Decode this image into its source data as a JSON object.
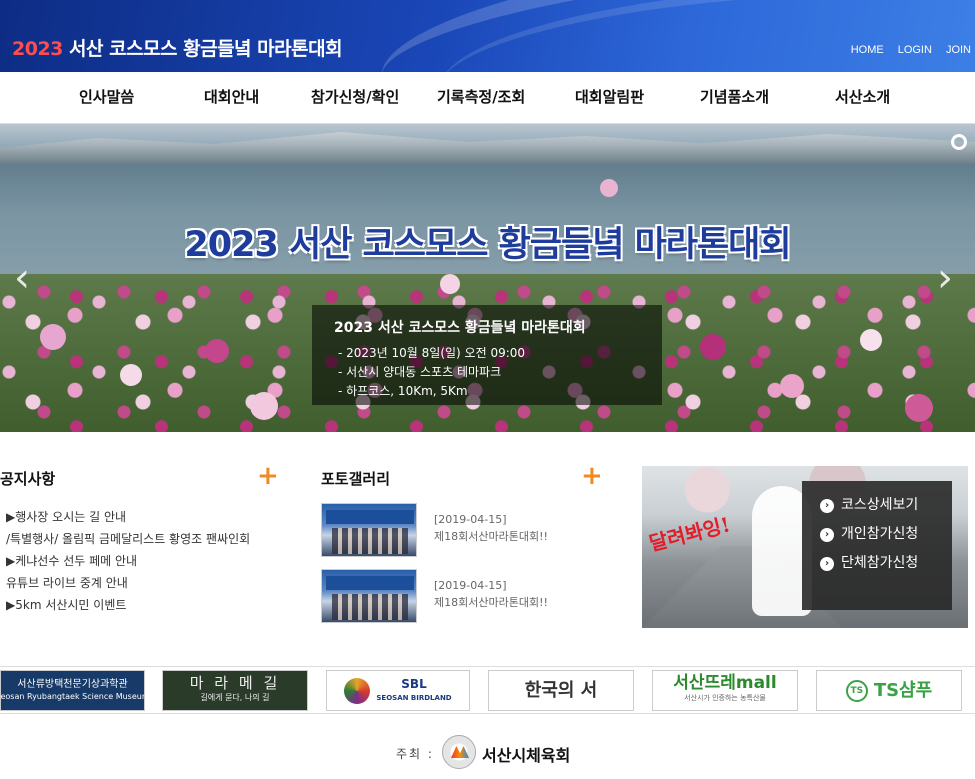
{
  "header": {
    "title_year": "2023",
    "title_text": " 서산 코스모스 황금들녘 마라톤대회",
    "util_links": [
      "HOME",
      "LOGIN",
      "JOIN"
    ]
  },
  "nav": {
    "items": [
      "인사말씀",
      "대회안내",
      "참가신청/확인",
      "기록측정/조회",
      "대회알림판",
      "기념품소개",
      "서산소개"
    ]
  },
  "hero": {
    "title": "2023 서산 코스모스 황금들녘 마라톤대회",
    "box_title": "2023 서산 코스모스 황금들녘 마라톤대회",
    "box_lines": [
      "- 2023년 10월 8일(일) 오전 09:00",
      "- 서산시 양대동 스포츠 테마파크",
      "- 하프코스, 10Km, 5Km"
    ]
  },
  "notice": {
    "title": "공지사항",
    "items": [
      "▶행사장 오시는 길 안내",
      "/특별행사/ 올림픽 금메달리스트 황영조 팬싸인회",
      "▶케냐선수 선두 페메 안내",
      "유튜브 라이브 중계 안내",
      "▶5km 서산시민 이벤트"
    ]
  },
  "gallery": {
    "title": "포토갤러리",
    "items": [
      {
        "date": "[2019-04-15]",
        "name": "제18회서산마라톤대회!!"
      },
      {
        "date": "[2019-04-15]",
        "name": "제18회서산마라톤대회!!"
      }
    ]
  },
  "promo": {
    "script_text": "달려봐잉!",
    "menu": [
      "코스상세보기",
      "개인참가신청",
      "단체참가신청"
    ]
  },
  "sponsors": {
    "s1": "서산류방택천문기상과학관",
    "s1_sub": "Seosan Ryubangtaek Science Museum",
    "s2": "마 라 메 길",
    "s2_sub": "길에게 묻다, 나의 길",
    "s3": "SBL",
    "s3_sub": "SEOSAN BIRDLAND",
    "s4": "한국의 서",
    "s5": "서산뜨레mall",
    "s5_sub": "서산시가 인증하는 농특산물",
    "s6_badge": "TS",
    "s6": "TS샴푸"
  },
  "footer": {
    "host_label": "주최 :",
    "host_name": "서산시체육회"
  },
  "colors": {
    "header_blue": "#1a47b8",
    "accent_orange": "#f08a24",
    "year_red": "#ff4d4d",
    "hero_title_blue": "#1d3c9c"
  }
}
